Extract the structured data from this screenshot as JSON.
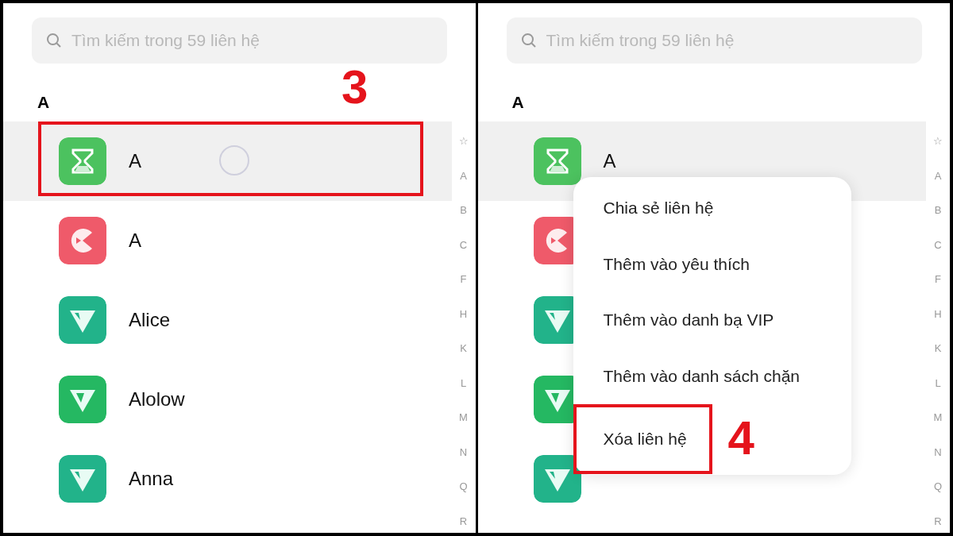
{
  "panels": [
    {
      "search": {
        "placeholder": "Tìm kiếm trong 59 liên hệ"
      },
      "section": "A",
      "step": "3",
      "contacts": [
        {
          "name": "A",
          "kind": "hourglass",
          "color": "#4cc25f",
          "selected": true,
          "highlighted": true,
          "touched": true
        },
        {
          "name": "A",
          "kind": "pacman",
          "color": "#ef5a6a",
          "selected": false,
          "highlighted": false,
          "touched": false
        },
        {
          "name": "Alice",
          "kind": "triangle",
          "color": "#22b38a",
          "selected": false,
          "highlighted": false,
          "touched": false
        },
        {
          "name": "Alolow",
          "kind": "w",
          "color": "#25b862",
          "selected": false,
          "highlighted": false,
          "touched": false
        },
        {
          "name": "Anna",
          "kind": "triangle",
          "color": "#22b38a",
          "selected": false,
          "highlighted": false,
          "touched": false
        }
      ],
      "index": [
        "☆",
        "A",
        "B",
        "C",
        "F",
        "H",
        "K",
        "L",
        "M",
        "N",
        "Q",
        "R"
      ]
    },
    {
      "search": {
        "placeholder": "Tìm kiếm trong 59 liên hệ"
      },
      "section": "A",
      "step": "4",
      "contacts": [
        {
          "name": "A",
          "kind": "hourglass",
          "color": "#4cc25f",
          "selected": true,
          "highlighted": false
        },
        {
          "kind": "pacman",
          "color": "#ef5a6a",
          "selected": false,
          "highlighted": false
        },
        {
          "kind": "triangle",
          "color": "#22b38a",
          "selected": false,
          "highlighted": false
        },
        {
          "kind": "w",
          "color": "#25b862",
          "selected": false,
          "highlighted": false
        },
        {
          "kind": "triangle",
          "color": "#22b38a",
          "selected": false,
          "highlighted": false
        }
      ],
      "index": [
        "☆",
        "A",
        "B",
        "C",
        "F",
        "H",
        "K",
        "L",
        "M",
        "N",
        "Q",
        "R"
      ],
      "menu": [
        {
          "label": "Chia sẻ liên hệ",
          "highlighted": false
        },
        {
          "label": "Thêm vào yêu thích",
          "highlighted": false
        },
        {
          "label": "Thêm vào danh bạ VIP",
          "highlighted": false
        },
        {
          "label": "Thêm vào danh sách chặn",
          "highlighted": false
        },
        {
          "label": "Xóa liên hệ",
          "highlighted": true
        }
      ]
    }
  ]
}
